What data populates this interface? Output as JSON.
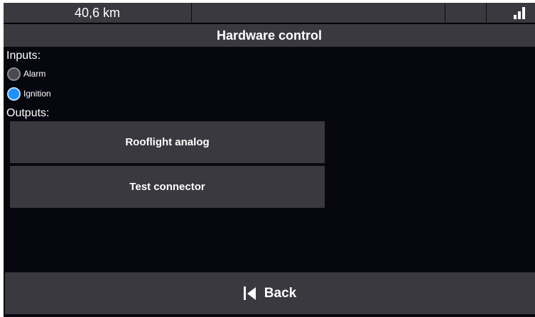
{
  "statusbar": {
    "distance": "40,6 km",
    "signal_icon": "signal-strength-icon"
  },
  "title": "Hardware control",
  "inputs": {
    "label": "Inputs:",
    "items": [
      {
        "label": "Alarm",
        "state": "off"
      },
      {
        "label": "Ignition",
        "state": "on"
      }
    ]
  },
  "outputs": {
    "label": "Outputs:",
    "buttons": [
      {
        "label": "Rooflight analog"
      },
      {
        "label": "Test connector"
      }
    ]
  },
  "back": {
    "label": "Back",
    "icon": "skip-back-icon"
  },
  "colors": {
    "background": "#07080f",
    "panel": "#3a393f",
    "active_indicator": "#1e90ff"
  }
}
